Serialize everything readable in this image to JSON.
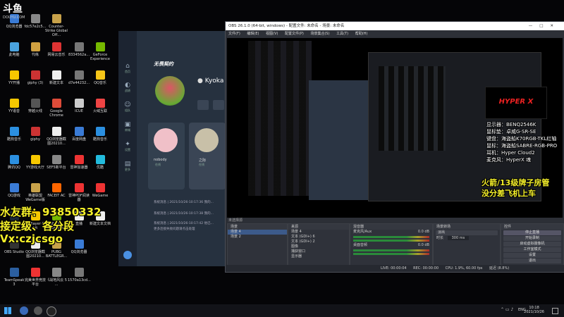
{
  "watermark": "斗鱼",
  "watermark_sub": "DOUYU.COM",
  "desktop_icons": [
    {
      "label": "QQ浏览器",
      "color": "#3a7bd5"
    },
    {
      "label": "fdc57e2c5...",
      "color": "#888"
    },
    {
      "label": "Counter-Strike Global Off...",
      "color": "#c8a24a"
    },
    {
      "label": "此电脑",
      "color": "#4aa3df"
    },
    {
      "label": "代练",
      "color": "#d0a040"
    },
    {
      "label": "网易云音乐",
      "color": "#d33"
    },
    {
      "label": "8334562a...",
      "color": "#777"
    },
    {
      "label": "GeForce Experience",
      "color": "#76b900"
    },
    {
      "label": "YY开播",
      "color": "#f7c800"
    },
    {
      "label": "giphy (3)",
      "color": "#c33"
    },
    {
      "label": "新建文本",
      "color": "#eee"
    },
    {
      "label": "d7e44232...",
      "color": "#777"
    },
    {
      "label": "QQ音乐",
      "color": "#f5c518"
    },
    {
      "label": "YY语音",
      "color": "#f7c800"
    },
    {
      "label": "穿越火线",
      "color": "#555"
    },
    {
      "label": "Google Chrome",
      "color": "#dd4b39"
    },
    {
      "label": "ICUE",
      "color": "#ccc"
    },
    {
      "label": "火绒互联",
      "color": "#e44"
    },
    {
      "label": "酷狗音乐",
      "color": "#2b8fe0"
    },
    {
      "label": "giphy",
      "color": "#c33"
    },
    {
      "label": "QQ浏览器截图20210...",
      "color": "#eee"
    },
    {
      "label": "百度网盘",
      "color": "#3a7bd5"
    },
    {
      "label": "酷狗音乐",
      "color": "#2b8fe0"
    },
    {
      "label": "腾讯QQ",
      "color": "#2b8fe0"
    },
    {
      "label": "YY游戏大厅",
      "color": "#f7c800"
    },
    {
      "label": "SEF5新平台",
      "color": "#888"
    },
    {
      "label": "雷神加速器",
      "color": "#e33"
    },
    {
      "label": "优酷",
      "color": "#2bd"
    },
    {
      "label": "QQ游戏",
      "color": "#3a7bd5"
    },
    {
      "label": "英雄联盟 WeGame版",
      "color": "#c8a24a"
    },
    {
      "label": "FACEIT AC",
      "color": "#f60"
    },
    {
      "label": "雷神PDF阅读器",
      "color": "#e33"
    },
    {
      "label": "WeGame",
      "color": "#e33"
    },
    {
      "label": "Steam",
      "color": "#1b2838"
    },
    {
      "label": "PotPlayer 64 bit",
      "color": "#f7c800"
    },
    {
      "label": "NVIDIA Broadcast",
      "color": "#76b900"
    },
    {
      "label": "直播",
      "color": "#eee"
    },
    {
      "label": "新建文本文档",
      "color": "#eee"
    },
    {
      "label": "OBS Studio",
      "color": "#333"
    },
    {
      "label": "QQ浏览器截图20210...",
      "color": "#eee"
    },
    {
      "label": "PUBG BATTLEGR...",
      "color": "#c8a24a"
    },
    {
      "label": "QQ浏览器",
      "color": "#3a7bd5"
    },
    {
      "label": "TeamSpeak 3",
      "color": "#2b5fa0"
    },
    {
      "label": "完美世界竞技平台",
      "color": "#e33"
    },
    {
      "label": "《战地风云 5 ...",
      "color": "#888"
    },
    {
      "label": "1570a13cd...",
      "color": "#777"
    }
  ],
  "game_client": {
    "title": "无畏契约",
    "player_name": "Kyoka",
    "nav": [
      "首页",
      "战绩",
      "组队",
      "商城",
      "设置",
      "更多"
    ],
    "party": [
      {
        "name": "nobody",
        "sub": "在线"
      },
      {
        "name": "之际",
        "sub": "在线"
      }
    ],
    "logs": [
      "系统消息 | 2021/10/26-10:17:36 我的...",
      "系统消息 | 2021/10/26-10:17:38 我的...",
      "系统消息 | 2021/10/26-10:17:42 他已...",
      "更多连接失败问题请点击处理"
    ]
  },
  "obs": {
    "title": "OBS 26.1.0 (64-bit, windows) - 配置文件: 未命名 - 场景: 未命名",
    "menu": [
      "文件(F)",
      "编辑(E)",
      "视图(V)",
      "配置文件(P)",
      "场景集合(S)",
      "工具(T)",
      "帮助(H)"
    ],
    "preview_badge": "未选择源",
    "docks": {
      "scenes": {
        "title": "场景",
        "items": [
          "场景 4",
          "场景 2"
        ]
      },
      "sources": {
        "title": "来源",
        "items": [
          "场景 4",
          "文本 (GDI+) 6",
          "文本 (GDI+) 2",
          "图像",
          "捕获窗口",
          "显示器"
        ]
      },
      "mixer": {
        "title": "混音器",
        "channels": [
          {
            "name": "麦克风/Aux",
            "db": "0.0 dB"
          },
          {
            "name": "桌面音频",
            "db": "0.0 dB"
          }
        ]
      },
      "transitions": {
        "title": "场景转场",
        "type": "淡出",
        "duration_label": "时长",
        "duration": "300 ms"
      },
      "controls": {
        "title": "控件",
        "buttons": [
          "停止直播",
          "开始录制",
          "启动虚拟摄像机",
          "工作室模式",
          "设置",
          "退出"
        ]
      }
    },
    "status": {
      "live": "LIVE: 00:00:04",
      "rec": "REC: 00:00:00",
      "cpu": "CPU: 1.9%, 60.00 fps",
      "dropped": "延迟 (8.8%)"
    }
  },
  "overlay_left": {
    "line1": "水友群：93850332",
    "line2": "接定级、各分段",
    "line3": "Vx:czjcsgo"
  },
  "overlay_right": {
    "specs": [
      "显示器：BENQ2546K",
      "鼠标垫：卓威G-SR-SE",
      "键盘：海盗船K70RGB-TKL红轴",
      "鼠标：海盗船SABRE-RGB-PRO",
      "耳机：Hyper Cloud2",
      "麦克风：HyperX 魂"
    ],
    "slogan1": "火箭/13级牌子房管",
    "slogan2": "没分差飞机上车"
  },
  "hyperx_logo": "HYPER X",
  "taskbar": {
    "lang": "ENG",
    "time": "10:18",
    "date": "2021/10/26"
  },
  "colors": {
    "accent_yellow": "#f5f02a",
    "obs_bg": "#2a2d34"
  }
}
